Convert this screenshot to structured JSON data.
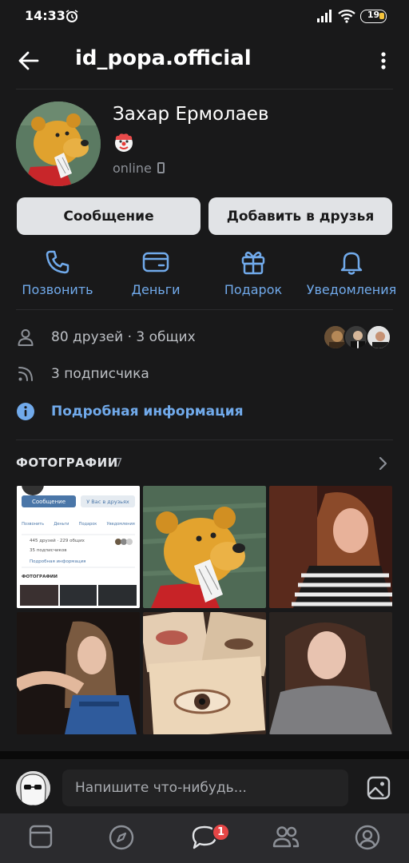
{
  "status_bar": {
    "time": "14:33",
    "battery": "19"
  },
  "header": {
    "title": "id_popa.official"
  },
  "profile": {
    "name": "Захар Ермолаев",
    "presence": "online"
  },
  "buttons": {
    "message": "Сообщение",
    "add_friend": "Добавить в друзья"
  },
  "actions": [
    {
      "label": "Позвонить",
      "icon": "phone-icon"
    },
    {
      "label": "Деньги",
      "icon": "money-icon"
    },
    {
      "label": "Подарок",
      "icon": "gift-icon"
    },
    {
      "label": "Уведомления",
      "icon": "bell-icon"
    }
  ],
  "info": {
    "friends": "80 друзей · 3 общих",
    "followers": "3 подписчика",
    "details": "Подробная информация"
  },
  "photos": {
    "title": "ФОТОГРАФИИ",
    "count": "7"
  },
  "screenshot_photo": {
    "message": "Сообщение",
    "friends": "У Вас в друзьях",
    "actions": [
      "Позвонить",
      "Деньги",
      "Подарок",
      "Уведомления"
    ],
    "friends_count": "445 друзей · 229 общих",
    "followers": "35 подписчиков",
    "details": "Подробная информация",
    "photos_title": "ФОТОГРАФИИ"
  },
  "composer": {
    "placeholder": "Напишите что-нибудь..."
  },
  "tabbar": {
    "messages_badge": "1"
  },
  "colors": {
    "accent": "#71aaeb",
    "background": "#19191a",
    "badge": "#e64646"
  }
}
